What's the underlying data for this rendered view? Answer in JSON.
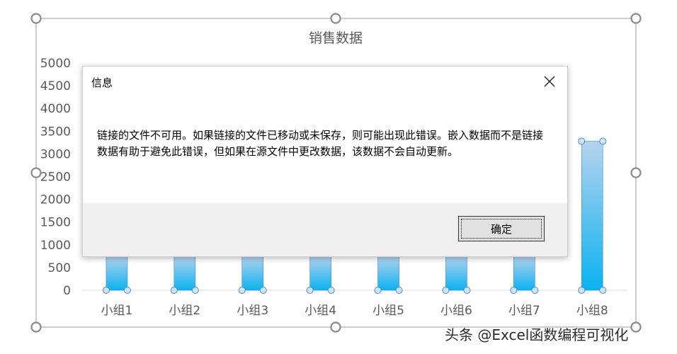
{
  "chart_data": {
    "type": "bar",
    "title": "销售数据",
    "categories": [
      "小组1",
      "小组2",
      "小组3",
      "小组4",
      "小组5",
      "小组6",
      "小组7",
      "小组8"
    ],
    "values": [
      750,
      750,
      750,
      750,
      750,
      750,
      750,
      3280
    ],
    "yticks": [
      "0",
      "500",
      "1000",
      "1500",
      "2000",
      "2500",
      "3000",
      "3500",
      "4000",
      "4500",
      "5000"
    ],
    "ylim": [
      0,
      5000
    ],
    "grid": false,
    "legend": "none",
    "colors": {
      "bar_top": "#b6d3ee",
      "bar_bottom": "#0ab2f1",
      "handle": "#8a8a8a",
      "point": "#9bc4ea"
    }
  },
  "dialog": {
    "title": "信息",
    "message": "链接的文件不可用。如果链接的文件已移动或未保存，则可能出现此错误。嵌入数据而不是链接数据有助于避免此错误，但如果在源文件中更改数据，该数据不会自动更新。",
    "ok_label": "确定"
  },
  "watermark": "头条 @Excel函数编程可视化"
}
